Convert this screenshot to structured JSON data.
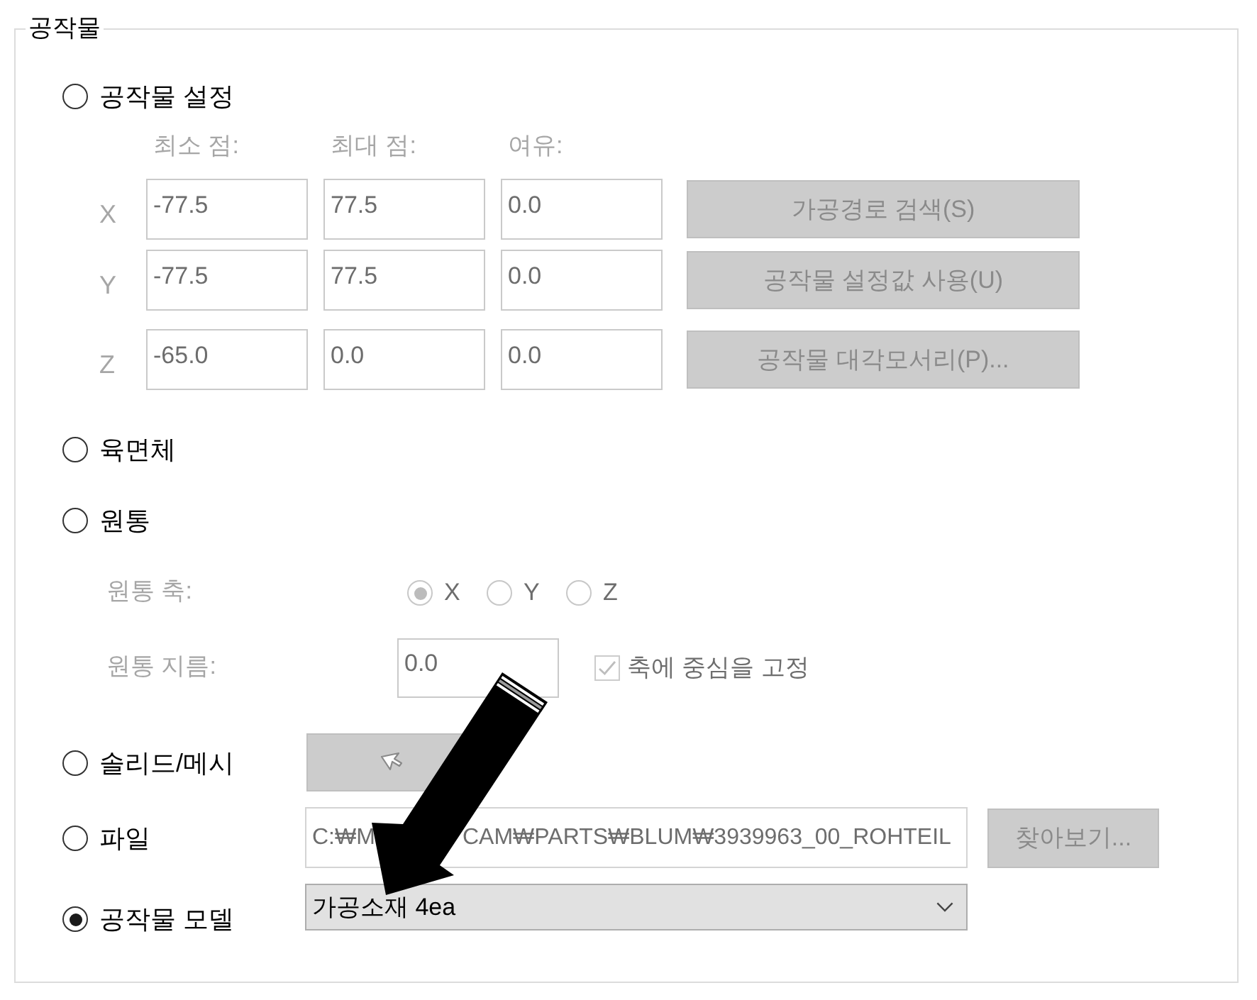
{
  "group_box": {
    "title": "공작물"
  },
  "options": [
    {
      "kind": "bounds",
      "label": "공작물 설정",
      "selected": false,
      "controls_disabled": true,
      "bounds": {
        "column_headers": [
          "최소 점:",
          "최대 점:",
          "여유:"
        ],
        "rows": [
          {
            "axis": "X",
            "values": [
              "-77.5",
              "77.5",
              "0.0"
            ],
            "button": "가공경로 검색(S)"
          },
          {
            "axis": "Y",
            "values": [
              "-77.5",
              "77.5",
              "0.0"
            ],
            "button": "공작물 설정값 사용(U)"
          },
          {
            "axis": "Z",
            "values": [
              "-65.0",
              "0.0",
              "0.0"
            ],
            "button": "공작물 대각모서리(P)..."
          }
        ]
      }
    },
    {
      "kind": "plain",
      "label": "육면체",
      "selected": false
    },
    {
      "kind": "cylinder",
      "label": "원통",
      "selected": false,
      "controls_disabled": true,
      "cylinder": {
        "axis_label": "원통 축:",
        "axis_choices": [
          {
            "label": "X",
            "selected": true
          },
          {
            "label": "Y",
            "selected": false
          },
          {
            "label": "Z",
            "selected": false
          }
        ],
        "diameter_label": "원통 지름:",
        "diameter_value": "0.0",
        "center_checkbox": {
          "label": "축에 중심을 고정",
          "checked": true
        }
      }
    },
    {
      "kind": "solid",
      "label": "솔리드/메시",
      "selected": false,
      "controls_disabled": true
    },
    {
      "kind": "file",
      "label": "파일",
      "selected": false,
      "controls_disabled": true,
      "file": {
        "path_visible_parts": [
          "C:₩M",
          "CAM₩PARTS₩BLUM₩3939963_00_ROHTEIL"
        ],
        "browse_button": "찾아보기..."
      }
    },
    {
      "kind": "model",
      "label": "공작물 모델",
      "selected": true,
      "controls_disabled": false,
      "dropdown": {
        "value": "가공소재 4ea"
      }
    }
  ]
}
